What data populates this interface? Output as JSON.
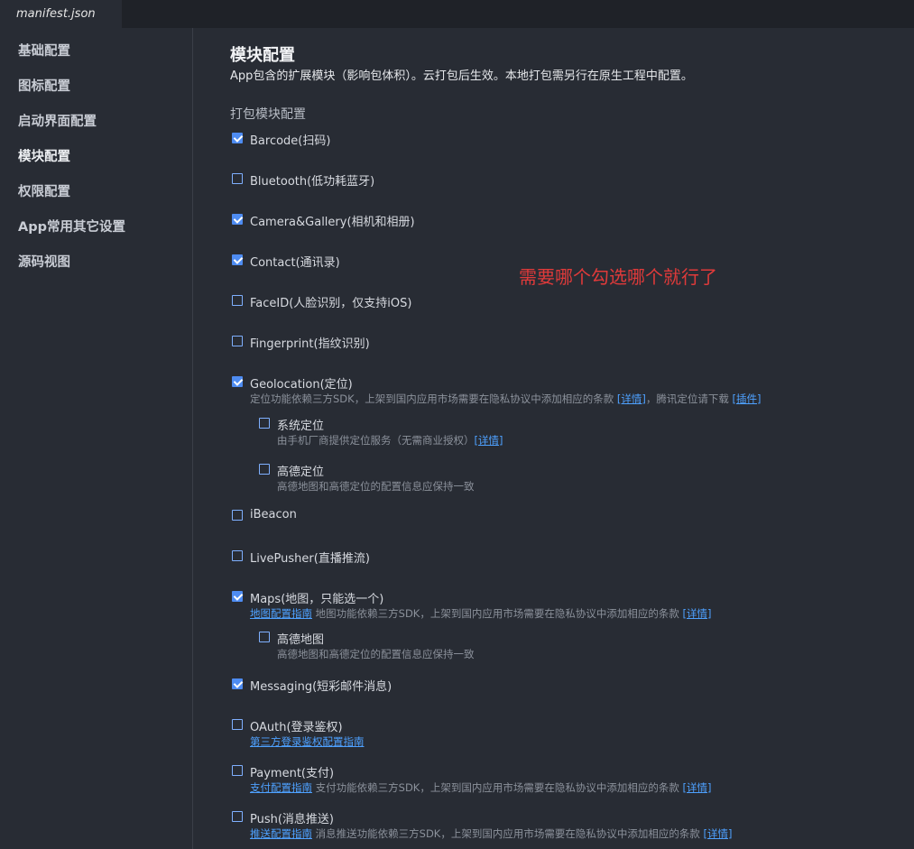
{
  "tab": {
    "title": "manifest.json"
  },
  "sidebar": {
    "items": [
      {
        "label": "基础配置"
      },
      {
        "label": "图标配置"
      },
      {
        "label": "启动界面配置"
      },
      {
        "label": "模块配置"
      },
      {
        "label": "权限配置"
      },
      {
        "label": "App常用其它设置"
      },
      {
        "label": "源码视图"
      }
    ],
    "active_index": 3
  },
  "main": {
    "title": "模块配置",
    "description": "App包含的扩展模块（影响包体积）。云打包后生效。本地打包需另行在原生工程中配置。",
    "section_title": "打包模块配置",
    "annotation": "需要哪个勾选哪个就行了",
    "annotation_color": "#e03a3a",
    "accent_color": "#4e8cf2",
    "modules": {
      "barcode": {
        "label": "Barcode(扫码)",
        "checked": true
      },
      "bluetooth": {
        "label": "Bluetooth(低功耗蓝牙)",
        "checked": false
      },
      "camera": {
        "label": "Camera&Gallery(相机和相册)",
        "checked": true
      },
      "contact": {
        "label": "Contact(通讯录)",
        "checked": true
      },
      "faceid": {
        "label": "FaceID(人脸识别，仅支持iOS)",
        "checked": false
      },
      "fingerprint": {
        "label": "Fingerprint(指纹识别)",
        "checked": false
      },
      "geolocation": {
        "label": "Geolocation(定位)",
        "checked": true,
        "note_text": "定位功能依赖三方SDK，上架到国内应用市场需要在隐私协议中添加相应的条款",
        "note_link": "[详情]",
        "note_text2": "，腾讯定位请下载",
        "note_link2": "[插件]",
        "sub": {
          "system": {
            "label": "系统定位",
            "checked": false,
            "note_text": "由手机厂商提供定位服务（无需商业授权）",
            "note_link": "[详情]"
          },
          "amap": {
            "label": "高德定位",
            "checked": false,
            "note_text": "高德地图和高德定位的配置信息应保持一致"
          }
        }
      },
      "ibeacon": {
        "label": "iBeacon",
        "checked": false
      },
      "livepusher": {
        "label": "LivePusher(直播推流)",
        "checked": false
      },
      "maps": {
        "label": "Maps(地图，只能选一个)",
        "checked": true,
        "guide_link": "地图配置指南",
        "note_text": " 地图功能依赖三方SDK，上架到国内应用市场需要在隐私协议中添加相应的条款",
        "note_link": "[详情]",
        "sub": {
          "amap": {
            "label": "高德地图",
            "checked": false,
            "note_text": "高德地图和高德定位的配置信息应保持一致"
          }
        }
      },
      "messaging": {
        "label": "Messaging(短彩邮件消息)",
        "checked": true
      },
      "oauth": {
        "label": "OAuth(登录鉴权)",
        "checked": false,
        "guide_link": "第三方登录鉴权配置指南"
      },
      "payment": {
        "label": "Payment(支付)",
        "checked": false,
        "guide_link": "支付配置指南",
        "note_text": " 支付功能依赖三方SDK，上架到国内应用市场需要在隐私协议中添加相应的条款",
        "note_link": "[详情]"
      },
      "push": {
        "label": "Push(消息推送)",
        "checked": false,
        "guide_link": "推送配置指南",
        "note_text": " 消息推送功能依赖三方SDK，上架到国内应用市场需要在隐私协议中添加相应的条款",
        "note_link": "[详情]"
      }
    }
  }
}
